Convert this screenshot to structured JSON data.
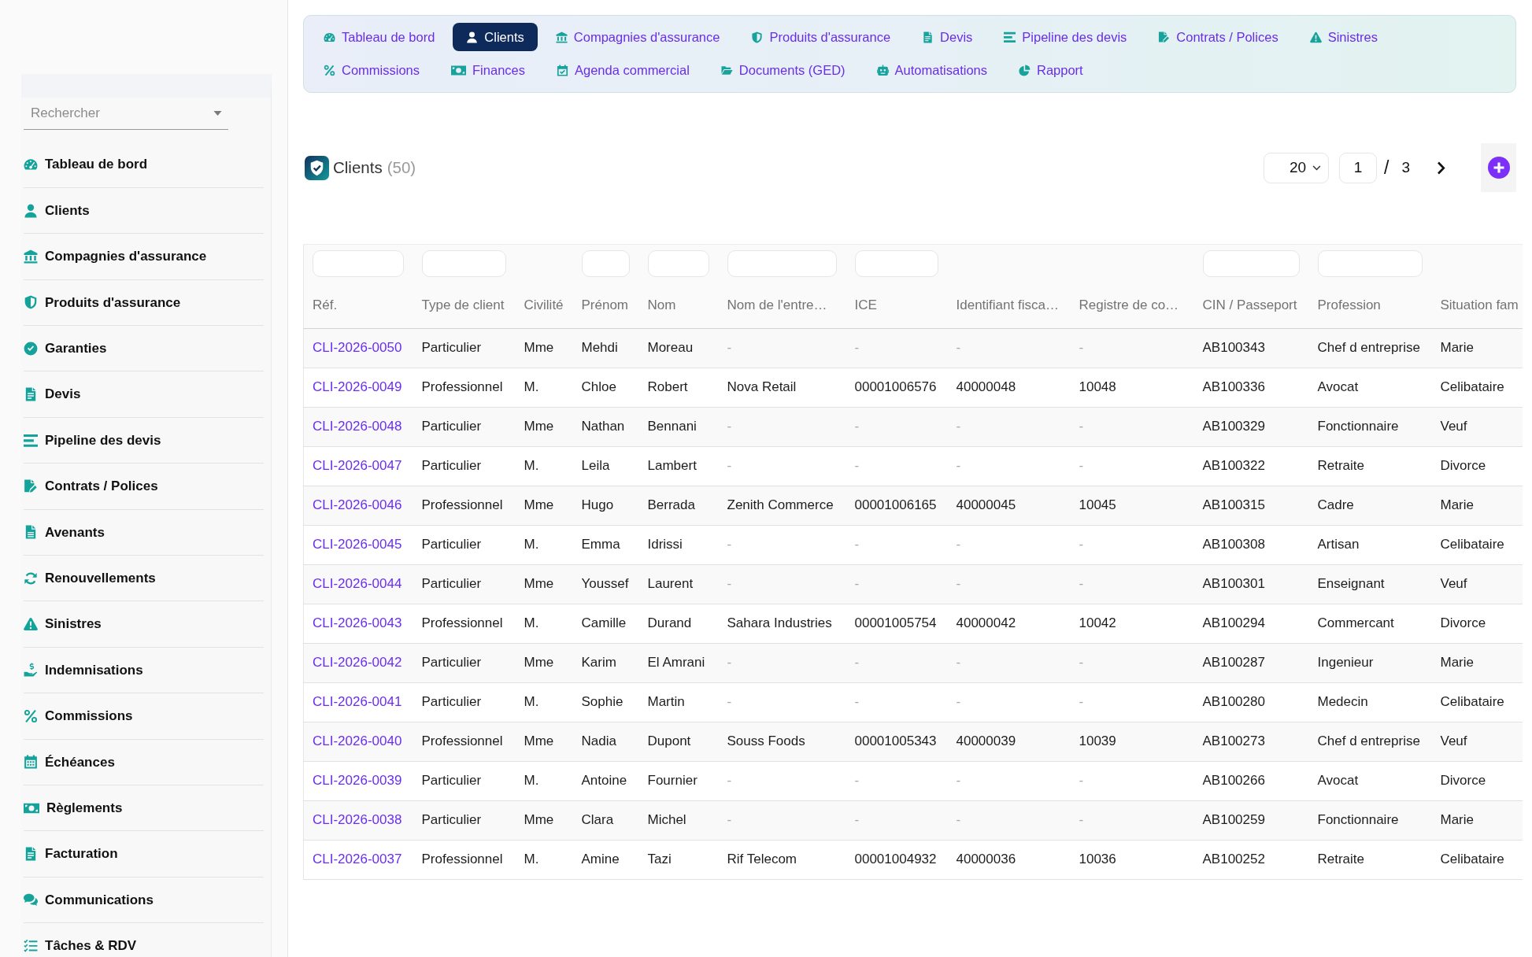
{
  "sidebar": {
    "search": {
      "placeholder": "Rechercher"
    },
    "items": [
      "Tableau de bord",
      "Clients",
      "Compagnies d'assurance",
      "Produits d'assurance",
      "Garanties",
      "Devis",
      "Pipeline des devis",
      "Contrats / Polices",
      "Avenants",
      "Renouvellements",
      "Sinistres",
      "Indemnisations",
      "Commissions",
      "Échéances",
      "Règlements",
      "Facturation",
      "Communications",
      "Tâches & RDV"
    ]
  },
  "nav": {
    "rows": [
      [
        {
          "label": "Tableau de bord",
          "selected": false
        },
        {
          "label": "Clients",
          "selected": true
        },
        {
          "label": "Compagnies d'assurance",
          "selected": false
        },
        {
          "label": "Produits d'assurance",
          "selected": false
        },
        {
          "label": "Devis",
          "selected": false
        },
        {
          "label": "Pipeline des devis",
          "selected": false
        },
        {
          "label": "Contrats / Polices",
          "selected": false
        },
        {
          "label": "Sinistres",
          "selected": false
        }
      ],
      [
        {
          "label": "Commissions",
          "selected": false
        },
        {
          "label": "Finances",
          "selected": false
        },
        {
          "label": "Agenda commercial",
          "selected": false
        },
        {
          "label": "Documents (GED)",
          "selected": false
        },
        {
          "label": "Automatisations",
          "selected": false
        },
        {
          "label": "Rapport",
          "selected": false
        }
      ]
    ]
  },
  "header": {
    "title": "Clients",
    "count": "(50)"
  },
  "pagination": {
    "page_size": "20",
    "page": "1",
    "separator": "/",
    "total": "3"
  },
  "table": {
    "columns": [
      {
        "label": "Réf.",
        "filter": true
      },
      {
        "label": "Type de client",
        "filter": true
      },
      {
        "label": "Civilité",
        "filter": false
      },
      {
        "label": "Prénom",
        "filter": true
      },
      {
        "label": "Nom",
        "filter": true
      },
      {
        "label": "Nom de l'entre…",
        "filter": true
      },
      {
        "label": "ICE",
        "filter": true
      },
      {
        "label": "Identifiant fisca…",
        "filter": false
      },
      {
        "label": "Registre de co…",
        "filter": false
      },
      {
        "label": "CIN / Passeport",
        "filter": true
      },
      {
        "label": "Profession",
        "filter": true
      },
      {
        "label": "Situation fam",
        "filter": false
      }
    ],
    "rows": [
      [
        "CLI-2026-0050",
        "Particulier",
        "Mme",
        "Mehdi",
        "Moreau",
        {
          "text": "-",
          "muted": true
        },
        {
          "text": "-",
          "muted": true
        },
        {
          "text": "-",
          "muted": true
        },
        {
          "text": "-",
          "muted": true
        },
        "AB100343",
        "Chef d entreprise",
        "Marie"
      ],
      [
        "CLI-2026-0049",
        "Professionnel",
        "M.",
        "Chloe",
        "Robert",
        "Nova Retail",
        "00001006576",
        "40000048",
        "10048",
        "AB100336",
        "Avocat",
        "Celibataire"
      ],
      [
        "CLI-2026-0048",
        "Particulier",
        "Mme",
        "Nathan",
        "Bennani",
        {
          "text": "-",
          "muted": true
        },
        {
          "text": "-",
          "muted": true
        },
        {
          "text": "-",
          "muted": true
        },
        {
          "text": "-",
          "muted": true
        },
        "AB100329",
        "Fonctionnaire",
        "Veuf"
      ],
      [
        "CLI-2026-0047",
        "Particulier",
        "M.",
        "Leila",
        "Lambert",
        {
          "text": "-",
          "muted": true
        },
        {
          "text": "-",
          "muted": true
        },
        {
          "text": "-",
          "muted": true
        },
        {
          "text": "-",
          "muted": true
        },
        "AB100322",
        "Retraite",
        "Divorce"
      ],
      [
        "CLI-2026-0046",
        "Professionnel",
        "Mme",
        "Hugo",
        "Berrada",
        "Zenith Commerce",
        "00001006165",
        "40000045",
        "10045",
        "AB100315",
        "Cadre",
        "Marie"
      ],
      [
        "CLI-2026-0045",
        "Particulier",
        "M.",
        "Emma",
        "Idrissi",
        {
          "text": "-",
          "muted": true
        },
        {
          "text": "-",
          "muted": true
        },
        {
          "text": "-",
          "muted": true
        },
        {
          "text": "-",
          "muted": true
        },
        "AB100308",
        "Artisan",
        "Celibataire"
      ],
      [
        "CLI-2026-0044",
        "Particulier",
        "Mme",
        "Youssef",
        "Laurent",
        {
          "text": "-",
          "muted": true
        },
        {
          "text": "-",
          "muted": true
        },
        {
          "text": "-",
          "muted": true
        },
        {
          "text": "-",
          "muted": true
        },
        "AB100301",
        "Enseignant",
        "Veuf"
      ],
      [
        "CLI-2026-0043",
        "Professionnel",
        "M.",
        "Camille",
        "Durand",
        "Sahara Industries",
        "00001005754",
        "40000042",
        "10042",
        "AB100294",
        "Commercant",
        "Divorce"
      ],
      [
        "CLI-2026-0042",
        "Particulier",
        "Mme",
        "Karim",
        "El Amrani",
        {
          "text": "-",
          "muted": true
        },
        {
          "text": "-",
          "muted": true
        },
        {
          "text": "-",
          "muted": true
        },
        {
          "text": "-",
          "muted": true
        },
        "AB100287",
        "Ingenieur",
        "Marie"
      ],
      [
        "CLI-2026-0041",
        "Particulier",
        "M.",
        "Sophie",
        "Martin",
        {
          "text": "-",
          "muted": true
        },
        {
          "text": "-",
          "muted": true
        },
        {
          "text": "-",
          "muted": true
        },
        {
          "text": "-",
          "muted": true
        },
        "AB100280",
        "Medecin",
        "Celibataire"
      ],
      [
        "CLI-2026-0040",
        "Professionnel",
        "Mme",
        "Nadia",
        "Dupont",
        "Souss Foods",
        "00001005343",
        "40000039",
        "10039",
        "AB100273",
        "Chef d entreprise",
        "Veuf"
      ],
      [
        "CLI-2026-0039",
        "Particulier",
        "M.",
        "Antoine",
        "Fournier",
        {
          "text": "-",
          "muted": true
        },
        {
          "text": "-",
          "muted": true
        },
        {
          "text": "-",
          "muted": true
        },
        {
          "text": "-",
          "muted": true
        },
        "AB100266",
        "Avocat",
        "Divorce"
      ],
      [
        "CLI-2026-0038",
        "Particulier",
        "Mme",
        "Clara",
        "Michel",
        {
          "text": "-",
          "muted": true
        },
        {
          "text": "-",
          "muted": true
        },
        {
          "text": "-",
          "muted": true
        },
        {
          "text": "-",
          "muted": true
        },
        "AB100259",
        "Fonctionnaire",
        "Marie"
      ],
      [
        "CLI-2026-0037",
        "Professionnel",
        "M.",
        "Amine",
        "Tazi",
        "Rif Telecom",
        "00001004932",
        "40000036",
        "10036",
        "AB100252",
        "Retraite",
        "Celibataire"
      ]
    ]
  }
}
